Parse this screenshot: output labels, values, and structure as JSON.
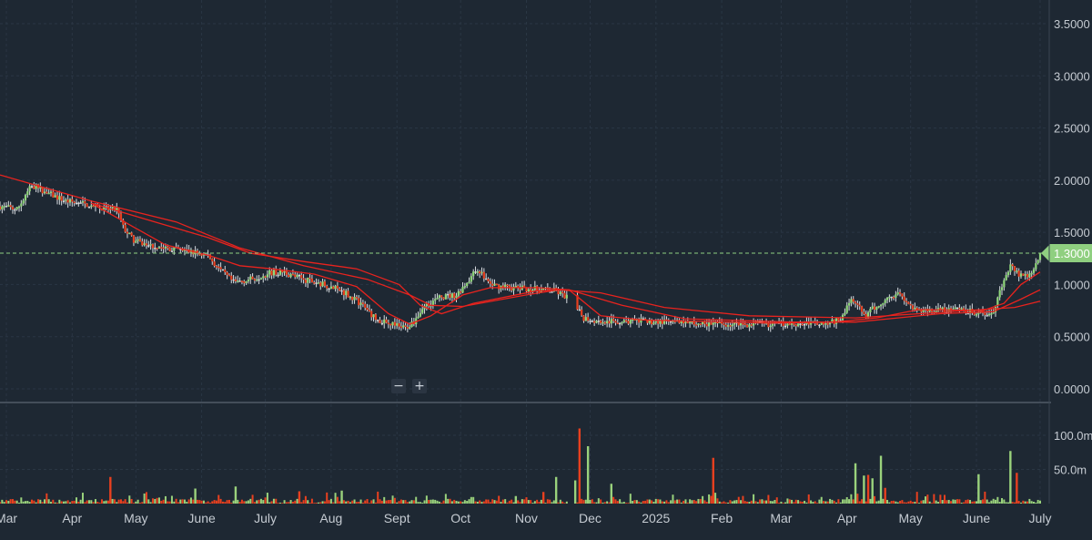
{
  "colors": {
    "background": "#1e2833",
    "grid": "#2a3644",
    "up": "#8fd67a",
    "down": "#e8401f",
    "neutral": "#d8d8d8",
    "ma": "#e8231e",
    "volume_up": "#9ad27c",
    "volume_down": "#e8401f",
    "last_price": "#8fcf80",
    "separator": "#6b7480"
  },
  "zoom": {
    "minus_label": "−",
    "plus_label": "+"
  },
  "chart_data": {
    "type": "candlestick",
    "price_axis": {
      "ylim": [
        0,
        3.7
      ],
      "ticks": [
        "3.5000",
        "3.0000",
        "2.5000",
        "2.0000",
        "1.5000",
        "1.0000",
        "0.5000",
        "0.0000"
      ],
      "tick_values": [
        3.5,
        3.0,
        2.5,
        2.0,
        1.5,
        1.0,
        0.5,
        0.0
      ]
    },
    "volume_axis": {
      "ylim": [
        0,
        130
      ],
      "ticks": [
        "100.0m",
        "50.0m"
      ],
      "tick_values": [
        100,
        50
      ]
    },
    "x_axis": {
      "labels": [
        "Mar",
        "Apr",
        "May",
        "June",
        "July",
        "Aug",
        "Sept",
        "Oct",
        "Nov",
        "Dec",
        "2025",
        "Feb",
        "Mar",
        "Apr",
        "May",
        "June",
        "July"
      ],
      "label_days": [
        0,
        31,
        61,
        92,
        122,
        153,
        184,
        214,
        245,
        275,
        306,
        337,
        365,
        396,
        426,
        457,
        487
      ],
      "domain_days": [
        -3,
        490
      ]
    },
    "last_price": {
      "value": 1.3,
      "label": "1.3000"
    },
    "price_anchors": [
      [
        -3,
        1.75
      ],
      [
        5,
        1.72
      ],
      [
        12,
        1.95
      ],
      [
        20,
        1.87
      ],
      [
        28,
        1.8
      ],
      [
        34,
        1.78
      ],
      [
        40,
        1.76
      ],
      [
        45,
        1.72
      ],
      [
        52,
        1.72
      ],
      [
        55,
        1.55
      ],
      [
        60,
        1.42
      ],
      [
        66,
        1.38
      ],
      [
        75,
        1.35
      ],
      [
        85,
        1.32
      ],
      [
        95,
        1.28
      ],
      [
        100,
        1.15
      ],
      [
        107,
        1.02
      ],
      [
        115,
        1.05
      ],
      [
        122,
        1.1
      ],
      [
        130,
        1.12
      ],
      [
        140,
        1.05
      ],
      [
        150,
        1.0
      ],
      [
        160,
        0.92
      ],
      [
        168,
        0.8
      ],
      [
        175,
        0.65
      ],
      [
        182,
        0.62
      ],
      [
        188,
        0.58
      ],
      [
        192,
        0.65
      ],
      [
        197,
        0.8
      ],
      [
        205,
        0.88
      ],
      [
        212,
        0.9
      ],
      [
        218,
        1.05
      ],
      [
        222,
        1.15
      ],
      [
        228,
        1.0
      ],
      [
        236,
        0.97
      ],
      [
        245,
        0.96
      ],
      [
        252,
        0.95
      ],
      [
        258,
        0.94
      ],
      [
        264,
        0.88
      ],
      [
        272,
        0.68
      ],
      [
        282,
        0.64
      ],
      [
        292,
        0.65
      ],
      [
        310,
        0.64
      ],
      [
        330,
        0.62
      ],
      [
        360,
        0.62
      ],
      [
        380,
        0.63
      ],
      [
        392,
        0.65
      ],
      [
        398,
        0.85
      ],
      [
        405,
        0.7
      ],
      [
        410,
        0.8
      ],
      [
        420,
        0.93
      ],
      [
        428,
        0.75
      ],
      [
        440,
        0.76
      ],
      [
        455,
        0.74
      ],
      [
        460,
        0.72
      ],
      [
        465,
        0.73
      ],
      [
        470,
        1.05
      ],
      [
        473,
        1.2
      ],
      [
        477,
        1.1
      ],
      [
        481,
        1.08
      ],
      [
        484,
        1.16
      ],
      [
        487,
        1.3
      ]
    ],
    "gap_days": [
      [
        265,
        268
      ]
    ],
    "moving_averages": [
      {
        "points": [
          [
            -3,
            2.05
          ],
          [
            40,
            1.8
          ],
          [
            80,
            1.6
          ],
          [
            110,
            1.35
          ],
          [
            140,
            1.18
          ],
          [
            170,
            1.05
          ],
          [
            190,
            0.9
          ],
          [
            200,
            0.8
          ],
          [
            215,
            0.79
          ],
          [
            245,
            0.9
          ],
          [
            260,
            0.95
          ],
          [
            280,
            0.92
          ],
          [
            310,
            0.78
          ],
          [
            350,
            0.7
          ],
          [
            400,
            0.68
          ],
          [
            430,
            0.72
          ],
          [
            460,
            0.76
          ],
          [
            475,
            0.78
          ],
          [
            487,
            0.84
          ]
        ]
      },
      {
        "points": [
          [
            40,
            1.78
          ],
          [
            70,
            1.6
          ],
          [
            95,
            1.45
          ],
          [
            115,
            1.3
          ],
          [
            140,
            1.22
          ],
          [
            165,
            1.15
          ],
          [
            185,
            1.0
          ],
          [
            195,
            0.8
          ],
          [
            205,
            0.72
          ],
          [
            220,
            0.82
          ],
          [
            250,
            0.94
          ],
          [
            265,
            0.95
          ],
          [
            290,
            0.8
          ],
          [
            320,
            0.67
          ],
          [
            370,
            0.64
          ],
          [
            400,
            0.64
          ],
          [
            420,
            0.68
          ],
          [
            440,
            0.72
          ],
          [
            465,
            0.74
          ],
          [
            478,
            0.86
          ],
          [
            487,
            0.95
          ]
        ]
      },
      {
        "points": [
          [
            40,
            1.78
          ],
          [
            60,
            1.55
          ],
          [
            75,
            1.38
          ],
          [
            95,
            1.28
          ],
          [
            110,
            1.18
          ],
          [
            125,
            1.15
          ],
          [
            145,
            1.1
          ],
          [
            165,
            0.98
          ],
          [
            180,
            0.72
          ],
          [
            190,
            0.62
          ],
          [
            200,
            0.7
          ],
          [
            215,
            0.9
          ],
          [
            228,
            0.97
          ],
          [
            250,
            0.97
          ],
          [
            265,
            0.95
          ],
          [
            280,
            0.7
          ],
          [
            300,
            0.66
          ],
          [
            360,
            0.63
          ],
          [
            390,
            0.64
          ],
          [
            410,
            0.68
          ],
          [
            430,
            0.76
          ],
          [
            460,
            0.75
          ],
          [
            470,
            0.82
          ],
          [
            478,
            1.0
          ],
          [
            487,
            1.12
          ]
        ]
      }
    ],
    "volume_spikes": [
      [
        49,
        39
      ],
      [
        89,
        22
      ],
      [
        108,
        25
      ],
      [
        138,
        18
      ],
      [
        158,
        19
      ],
      [
        240,
        11
      ],
      [
        253,
        17
      ],
      [
        259,
        39
      ],
      [
        268,
        34
      ],
      [
        270,
        110
      ],
      [
        274,
        84
      ],
      [
        285,
        29
      ],
      [
        333,
        67
      ],
      [
        400,
        59
      ],
      [
        404,
        41
      ],
      [
        406,
        42
      ],
      [
        408,
        37
      ],
      [
        412,
        70
      ],
      [
        414,
        23
      ],
      [
        458,
        43
      ],
      [
        473,
        77
      ],
      [
        476,
        45
      ]
    ]
  }
}
